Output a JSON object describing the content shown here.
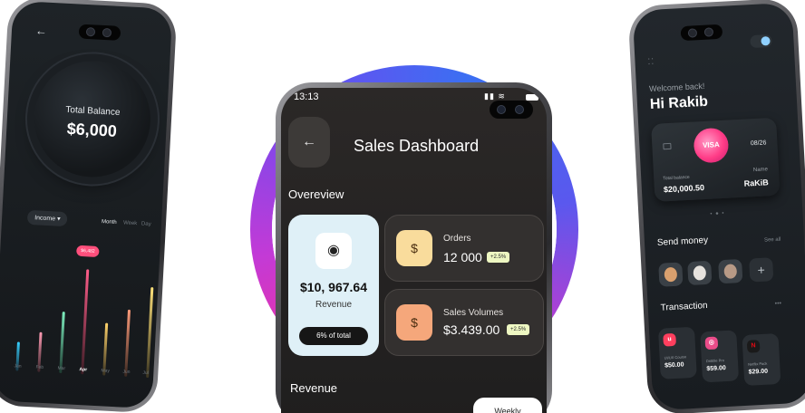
{
  "left_phone": {
    "back_icon": "arrow-left-icon",
    "balance_label": "Total Balance",
    "balance_value": "$6,000",
    "income_filter": "Income",
    "periods": [
      "Month",
      "Week",
      "Day"
    ],
    "tooltip": "$6,482",
    "months": [
      "Jan",
      "Feb",
      "Mar",
      "Apr",
      "May",
      "Jun",
      "Jul"
    ],
    "selected_month": "Apr"
  },
  "right_phone": {
    "welcome": "Welcome back!",
    "greeting": "Hi Rakib",
    "card": {
      "brand": "VISA",
      "expiry": "08/26",
      "total_label": "Total balance",
      "total_value": "$20,000.50",
      "name_label": "Name",
      "name_value": "RaKiB"
    },
    "send_money_label": "Send money",
    "see_all": "See all",
    "transaction_label": "Transaction",
    "transactions": [
      {
        "title": "UI/UX Course",
        "price": "$50.00",
        "icon": "u-logo-icon",
        "color": "#ff3f5e"
      },
      {
        "title": "Dribble Pro",
        "price": "$59.00",
        "icon": "dribbble-icon",
        "color": "#ea4c89"
      },
      {
        "title": "Netflix Pack",
        "price": "$29.00",
        "icon": "netflix-icon",
        "color": "#e50914"
      }
    ]
  },
  "center_phone": {
    "status_time": "13:13",
    "title": "Sales Dashboard",
    "section_overview": "Overeview",
    "revenue_card": {
      "value": "$10, 967.64",
      "label": "Revenue",
      "pill": "6% of total",
      "bg": "#dff0f7"
    },
    "orders": {
      "label": "Orders",
      "value": "12 000",
      "change": "+2.5%",
      "icon_bg": "#f9dc9c"
    },
    "sales_volumes": {
      "label": "Sales Volumes",
      "value": "$3.439.00",
      "change": "+2.5%",
      "icon_bg": "#f5a77b"
    },
    "section_revenue": "Revenue",
    "period_button": "Weekly"
  }
}
